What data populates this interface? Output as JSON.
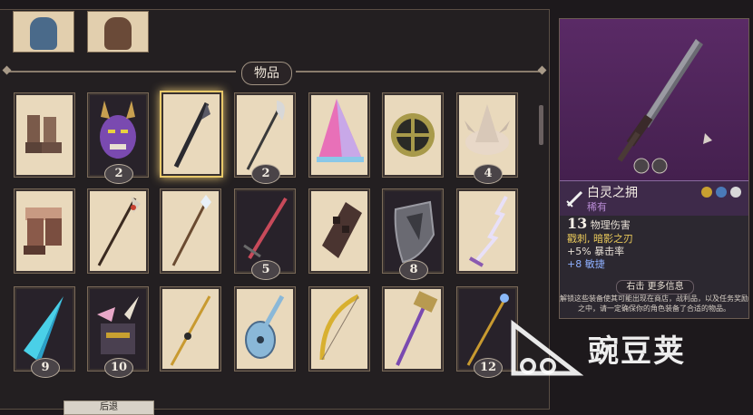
{
  "inventory": {
    "section_title": "物品",
    "items": [
      {
        "name": "boots",
        "badge": ""
      },
      {
        "name": "demon-mask",
        "badge": "2"
      },
      {
        "name": "dark-spear",
        "badge": ""
      },
      {
        "name": "glaive",
        "badge": "2"
      },
      {
        "name": "pink-hat",
        "badge": ""
      },
      {
        "name": "round-shield",
        "badge": ""
      },
      {
        "name": "spiked-helm",
        "badge": "4"
      },
      {
        "name": "leather-boots",
        "badge": ""
      },
      {
        "name": "halberd",
        "badge": ""
      },
      {
        "name": "crystal-staff",
        "badge": ""
      },
      {
        "name": "red-sword",
        "badge": "5"
      },
      {
        "name": "gauntlet",
        "badge": ""
      },
      {
        "name": "kite-shield",
        "badge": "8"
      },
      {
        "name": "lightning-sword",
        "badge": ""
      },
      {
        "name": "ice-drill",
        "badge": "9"
      },
      {
        "name": "horned-helm",
        "badge": "10"
      },
      {
        "name": "golden-spear",
        "badge": ""
      },
      {
        "name": "lute",
        "badge": ""
      },
      {
        "name": "golden-bow",
        "badge": ""
      },
      {
        "name": "war-hammer",
        "badge": ""
      },
      {
        "name": "magic-staff",
        "badge": "12"
      }
    ]
  },
  "detail": {
    "item_name": "白灵之拥",
    "rarity": "稀有",
    "damage_value": "13",
    "damage_label": "物理伤害",
    "traits": "戳刺, 暗影之刃",
    "bonus_crit": "+5% 暴击率",
    "bonus_agility": "+8 敏捷",
    "more_info": "右击 更多信息",
    "hint_line1": "解锁这些装备使其可能出现在商店，战利品，以及任务奖励",
    "hint_line2": "之中，请一定确保你的角色装备了合适的物品。"
  },
  "footer": {
    "back_label": "后退"
  },
  "watermark": {
    "text": "豌豆荚"
  },
  "colors": {
    "accent_gold": "#e8c96a",
    "rarity_purple": "#b78ad3",
    "trait_yellow": "#e8c85a",
    "bonus_blue": "#8fb0ff"
  }
}
